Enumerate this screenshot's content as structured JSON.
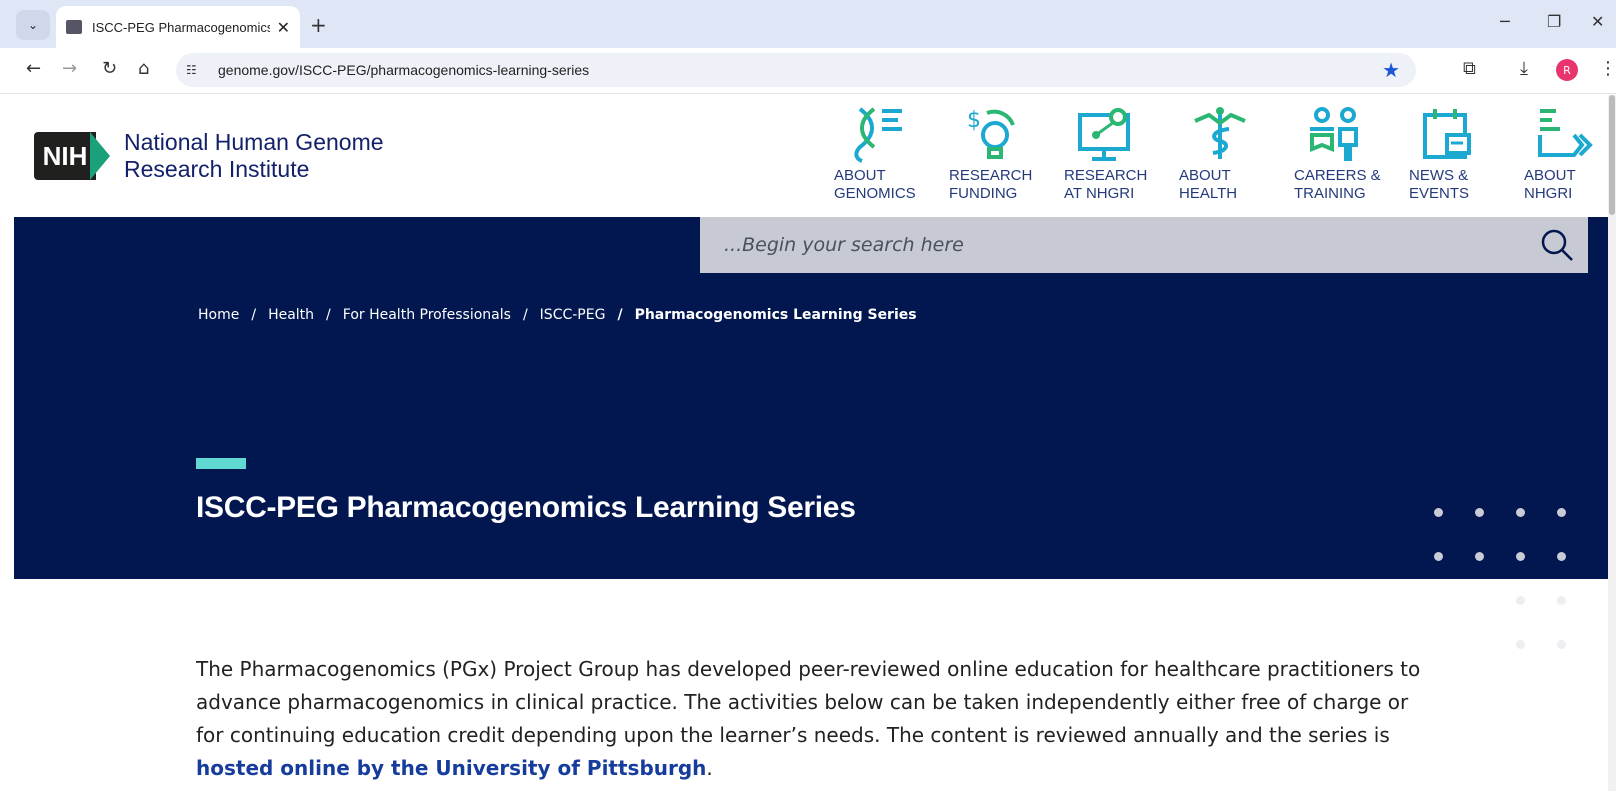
{
  "browser": {
    "tab_title": "ISCC-PEG Pharmacogenomics L",
    "url": "genome.gov/ISCC-PEG/pharmacogenomics-learning-series",
    "avatar_letter": "R"
  },
  "header": {
    "logo_text": "NIH",
    "institute_line1": "National Human Genome",
    "institute_line2": "Research Institute",
    "nav": [
      {
        "label": "ABOUT\nGENOMICS",
        "icon": "dna-icon"
      },
      {
        "label": "RESEARCH\nFUNDING",
        "icon": "funding-lightbulb-icon"
      },
      {
        "label": "RESEARCH\nAT NHGRI",
        "icon": "research-monitor-icon"
      },
      {
        "label": "ABOUT\nHEALTH",
        "icon": "caduceus-icon"
      },
      {
        "label": "CAREERS &\nTRAINING",
        "icon": "people-icon"
      },
      {
        "label": "NEWS &\nEVENTS",
        "icon": "calendar-icon"
      },
      {
        "label": "ABOUT\nNHGRI",
        "icon": "arrow-list-icon"
      }
    ]
  },
  "search": {
    "placeholder": "...Begin your search here"
  },
  "breadcrumb": {
    "items": [
      "Home",
      "Health",
      "For Health Professionals",
      "ISCC-PEG"
    ],
    "current": "Pharmacogenomics Learning Series"
  },
  "hero": {
    "title": "ISCC-PEG Pharmacogenomics Learning Series"
  },
  "intro": {
    "text": "The Pharmacogenomics (PGx) Project Group has developed peer-reviewed online education for healthcare practitioners to advance pharmacogenomics in clinical practice. The activities below can be taken independently either free of charge or for continuing education credit depending upon the learner’s needs. The content is reviewed annually and the series is ",
    "link": "hosted online by the University of Pittsburgh",
    "end": "."
  },
  "colors": {
    "hero_bg": "#021650",
    "accent": "#5fd9d1",
    "link": "#163c9c",
    "nav_text": "#243a7a"
  }
}
